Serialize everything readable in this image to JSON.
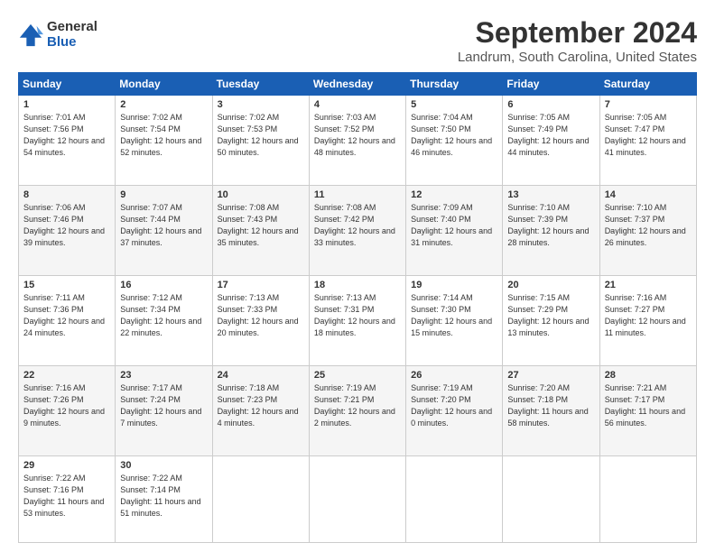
{
  "logo": {
    "general": "General",
    "blue": "Blue"
  },
  "title": "September 2024",
  "subtitle": "Landrum, South Carolina, United States",
  "headers": [
    "Sunday",
    "Monday",
    "Tuesday",
    "Wednesday",
    "Thursday",
    "Friday",
    "Saturday"
  ],
  "weeks": [
    [
      {
        "day": "1",
        "rise": "7:01 AM",
        "set": "7:56 PM",
        "daylight": "12 hours and 54 minutes."
      },
      {
        "day": "2",
        "rise": "7:02 AM",
        "set": "7:54 PM",
        "daylight": "12 hours and 52 minutes."
      },
      {
        "day": "3",
        "rise": "7:02 AM",
        "set": "7:53 PM",
        "daylight": "12 hours and 50 minutes."
      },
      {
        "day": "4",
        "rise": "7:03 AM",
        "set": "7:52 PM",
        "daylight": "12 hours and 48 minutes."
      },
      {
        "day": "5",
        "rise": "7:04 AM",
        "set": "7:50 PM",
        "daylight": "12 hours and 46 minutes."
      },
      {
        "day": "6",
        "rise": "7:05 AM",
        "set": "7:49 PM",
        "daylight": "12 hours and 44 minutes."
      },
      {
        "day": "7",
        "rise": "7:05 AM",
        "set": "7:47 PM",
        "daylight": "12 hours and 41 minutes."
      }
    ],
    [
      {
        "day": "8",
        "rise": "7:06 AM",
        "set": "7:46 PM",
        "daylight": "12 hours and 39 minutes."
      },
      {
        "day": "9",
        "rise": "7:07 AM",
        "set": "7:44 PM",
        "daylight": "12 hours and 37 minutes."
      },
      {
        "day": "10",
        "rise": "7:08 AM",
        "set": "7:43 PM",
        "daylight": "12 hours and 35 minutes."
      },
      {
        "day": "11",
        "rise": "7:08 AM",
        "set": "7:42 PM",
        "daylight": "12 hours and 33 minutes."
      },
      {
        "day": "12",
        "rise": "7:09 AM",
        "set": "7:40 PM",
        "daylight": "12 hours and 31 minutes."
      },
      {
        "day": "13",
        "rise": "7:10 AM",
        "set": "7:39 PM",
        "daylight": "12 hours and 28 minutes."
      },
      {
        "day": "14",
        "rise": "7:10 AM",
        "set": "7:37 PM",
        "daylight": "12 hours and 26 minutes."
      }
    ],
    [
      {
        "day": "15",
        "rise": "7:11 AM",
        "set": "7:36 PM",
        "daylight": "12 hours and 24 minutes."
      },
      {
        "day": "16",
        "rise": "7:12 AM",
        "set": "7:34 PM",
        "daylight": "12 hours and 22 minutes."
      },
      {
        "day": "17",
        "rise": "7:13 AM",
        "set": "7:33 PM",
        "daylight": "12 hours and 20 minutes."
      },
      {
        "day": "18",
        "rise": "7:13 AM",
        "set": "7:31 PM",
        "daylight": "12 hours and 18 minutes."
      },
      {
        "day": "19",
        "rise": "7:14 AM",
        "set": "7:30 PM",
        "daylight": "12 hours and 15 minutes."
      },
      {
        "day": "20",
        "rise": "7:15 AM",
        "set": "7:29 PM",
        "daylight": "12 hours and 13 minutes."
      },
      {
        "day": "21",
        "rise": "7:16 AM",
        "set": "7:27 PM",
        "daylight": "12 hours and 11 minutes."
      }
    ],
    [
      {
        "day": "22",
        "rise": "7:16 AM",
        "set": "7:26 PM",
        "daylight": "12 hours and 9 minutes."
      },
      {
        "day": "23",
        "rise": "7:17 AM",
        "set": "7:24 PM",
        "daylight": "12 hours and 7 minutes."
      },
      {
        "day": "24",
        "rise": "7:18 AM",
        "set": "7:23 PM",
        "daylight": "12 hours and 4 minutes."
      },
      {
        "day": "25",
        "rise": "7:19 AM",
        "set": "7:21 PM",
        "daylight": "12 hours and 2 minutes."
      },
      {
        "day": "26",
        "rise": "7:19 AM",
        "set": "7:20 PM",
        "daylight": "12 hours and 0 minutes."
      },
      {
        "day": "27",
        "rise": "7:20 AM",
        "set": "7:18 PM",
        "daylight": "11 hours and 58 minutes."
      },
      {
        "day": "28",
        "rise": "7:21 AM",
        "set": "7:17 PM",
        "daylight": "11 hours and 56 minutes."
      }
    ],
    [
      {
        "day": "29",
        "rise": "7:22 AM",
        "set": "7:16 PM",
        "daylight": "11 hours and 53 minutes."
      },
      {
        "day": "30",
        "rise": "7:22 AM",
        "set": "7:14 PM",
        "daylight": "11 hours and 51 minutes."
      },
      null,
      null,
      null,
      null,
      null
    ]
  ]
}
